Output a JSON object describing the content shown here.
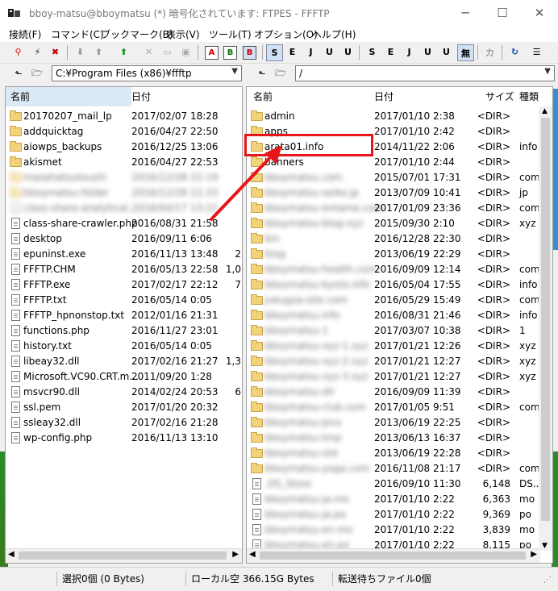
{
  "window": {
    "title": "bboy-matsu@bboymatsu (*) 暗号化されています: FTPES - FFFTP",
    "minimize_glyph": "─",
    "maximize_glyph": "☐",
    "close_glyph": "✕"
  },
  "menu": [
    "接続(F)",
    "コマンド(C)",
    "ブックマーク(B)",
    "表示(V)",
    "ツール(T)",
    "オプション(O)",
    "ヘルプ(H)"
  ],
  "toolbar": {
    "buttons_text": [
      "S",
      "E",
      "J",
      "U",
      "U",
      "S",
      "E",
      "J",
      "U",
      "U",
      "無",
      "カ"
    ],
    "badge_a": "A",
    "badge_b": "B",
    "badge_c": "B"
  },
  "local": {
    "path": "C:¥Program Files (x86)¥ffftp",
    "columns": {
      "name": "名前",
      "date": "日付"
    },
    "files": [
      {
        "name": "20170207_mail_lp",
        "date": "2017/02/07 18:28",
        "size": "",
        "type": "folder",
        "blur": false
      },
      {
        "name": "addquicktag",
        "date": "2016/04/27 22:50",
        "size": "",
        "type": "folder",
        "blur": false
      },
      {
        "name": "aiowps_backups",
        "date": "2016/12/25 13:06",
        "size": "",
        "type": "folder",
        "blur": false
      },
      {
        "name": "akismet",
        "date": "2016/04/27 22:53",
        "size": "",
        "type": "folder",
        "blur": false
      },
      {
        "name": "masahatsutoushi",
        "date": "2016/12/28 22:19",
        "size": "",
        "type": "folder",
        "blur": true
      },
      {
        "name": "bboymatsu-folder",
        "date": "2016/12/28 22:33",
        "size": "",
        "type": "folder",
        "blur": true
      },
      {
        "name": "class-share-analytical...",
        "date": "2016/04/17 13:22",
        "size": "",
        "type": "file",
        "blur": true
      },
      {
        "name": "class-share-crawler.php",
        "date": "2016/08/31 21:58",
        "size": "",
        "type": "file",
        "blur": false
      },
      {
        "name": "desktop",
        "date": "2016/09/11  6:06",
        "size": "",
        "type": "file",
        "blur": false
      },
      {
        "name": "epuninst.exe",
        "date": "2016/11/13 13:48",
        "size": "2",
        "type": "file",
        "blur": false
      },
      {
        "name": "FFFTP.CHM",
        "date": "2016/05/13 22:58",
        "size": "1,0",
        "type": "file",
        "blur": false
      },
      {
        "name": "FFFTP.exe",
        "date": "2017/02/17 22:12",
        "size": "7",
        "type": "file",
        "blur": false
      },
      {
        "name": "FFFTP.txt",
        "date": "2016/05/14  0:05",
        "size": "",
        "type": "file",
        "blur": false
      },
      {
        "name": "FFFTP_hpnonstop.txt",
        "date": "2012/01/16 21:31",
        "size": "",
        "type": "file",
        "blur": false
      },
      {
        "name": "functions.php",
        "date": "2016/11/27 23:01",
        "size": "",
        "type": "file",
        "blur": false
      },
      {
        "name": "history.txt",
        "date": "2016/05/14  0:05",
        "size": "",
        "type": "file",
        "blur": false
      },
      {
        "name": "libeay32.dll",
        "date": "2017/02/16 21:27",
        "size": "1,3",
        "type": "file",
        "blur": false
      },
      {
        "name": "Microsoft.VC90.CRT.m...",
        "date": "2011/09/20  1:28",
        "size": "",
        "type": "file",
        "blur": false
      },
      {
        "name": "msvcr90.dll",
        "date": "2014/02/24 20:53",
        "size": "6",
        "type": "file",
        "blur": false
      },
      {
        "name": "ssl.pem",
        "date": "2017/01/20 20:32",
        "size": "",
        "type": "file",
        "blur": false
      },
      {
        "name": "ssleay32.dll",
        "date": "2017/02/16 21:28",
        "size": "",
        "type": "file",
        "blur": false
      },
      {
        "name": "wp-config.php",
        "date": "2016/11/13 13:10",
        "size": "",
        "type": "file",
        "blur": false
      }
    ]
  },
  "remote": {
    "path": "/",
    "columns": {
      "name": "名前",
      "date": "日付",
      "size": "サイズ",
      "type": "種類"
    },
    "files": [
      {
        "name": "admin",
        "date": "2017/01/10  2:38",
        "size": "<DIR>",
        "ext": "",
        "type": "folder",
        "blur": false
      },
      {
        "name": "apps",
        "date": "2017/01/10  2:42",
        "size": "<DIR>",
        "ext": "",
        "type": "folder",
        "blur": false
      },
      {
        "name": "arata01.info",
        "date": "2014/11/22  2:06",
        "size": "<DIR>",
        "ext": "info",
        "type": "folder",
        "blur": false
      },
      {
        "name": "banners",
        "date": "2017/01/10  2:44",
        "size": "<DIR>",
        "ext": "",
        "type": "folder",
        "blur": false
      },
      {
        "name": "bboymatsu.com",
        "date": "2015/07/01 17:31",
        "size": "<DIR>",
        "ext": "com",
        "type": "folder",
        "blur": true
      },
      {
        "name": "bboymatsu-seiko.jp",
        "date": "2013/07/09 10:41",
        "size": "<DIR>",
        "ext": "jp",
        "type": "folder",
        "blur": true
      },
      {
        "name": "bboymatsu-entame.com",
        "date": "2017/01/09 23:36",
        "size": "<DIR>",
        "ext": "com",
        "type": "folder",
        "blur": true
      },
      {
        "name": "bboymatsu-blog-xyz",
        "date": "2015/09/30  2:10",
        "size": "<DIR>",
        "ext": "xyz",
        "type": "folder",
        "blur": true
      },
      {
        "name": "bin",
        "date": "2016/12/28 22:30",
        "size": "<DIR>",
        "ext": "",
        "type": "folder",
        "blur": true
      },
      {
        "name": "blog",
        "date": "2013/06/19 22:29",
        "size": "<DIR>",
        "ext": "",
        "type": "folder",
        "blur": true
      },
      {
        "name": "bboymatsu-health.com",
        "date": "2016/09/09 12:14",
        "size": "<DIR>",
        "ext": "com",
        "type": "folder",
        "blur": true
      },
      {
        "name": "bboymatsu-kyoto.info",
        "date": "2016/05/04 17:55",
        "size": "<DIR>",
        "ext": "info",
        "type": "folder",
        "blur": true
      },
      {
        "name": "jukugoa-site.com",
        "date": "2016/05/29 15:49",
        "size": "<DIR>",
        "ext": "com",
        "type": "folder",
        "blur": true
      },
      {
        "name": "bboymatsu.info",
        "date": "2016/08/31 21:46",
        "size": "<DIR>",
        "ext": "info",
        "type": "folder",
        "blur": true
      },
      {
        "name": "bboymatsu-1",
        "date": "2017/03/07 10:38",
        "size": "<DIR>",
        "ext": "1",
        "type": "folder",
        "blur": true
      },
      {
        "name": "bboymatsu-xyz-1.xyz",
        "date": "2017/01/21 12:26",
        "size": "<DIR>",
        "ext": "xyz",
        "type": "folder",
        "blur": true
      },
      {
        "name": "bboymatsu-xyz-2.xyz",
        "date": "2017/01/21 12:27",
        "size": "<DIR>",
        "ext": "xyz",
        "type": "folder",
        "blur": true
      },
      {
        "name": "bboymatsu-xyz-3.xyz",
        "date": "2017/01/21 12:27",
        "size": "<DIR>",
        "ext": "xyz",
        "type": "folder",
        "blur": true
      },
      {
        "name": "bboymatsu-dir",
        "date": "2016/09/09 11:39",
        "size": "<DIR>",
        "ext": "",
        "type": "folder",
        "blur": true
      },
      {
        "name": "bboymatsu-club.com",
        "date": "2017/01/05  9:51",
        "size": "<DIR>",
        "ext": "com",
        "type": "folder",
        "blur": true
      },
      {
        "name": "bboymatsu-pics",
        "date": "2013/06/19 22:25",
        "size": "<DIR>",
        "ext": "",
        "type": "folder",
        "blur": true
      },
      {
        "name": "bboymatsu-tmp",
        "date": "2013/06/13 16:37",
        "size": "<DIR>",
        "ext": "",
        "type": "folder",
        "blur": true
      },
      {
        "name": "bboymatsu-old",
        "date": "2013/06/19 22:28",
        "size": "<DIR>",
        "ext": "",
        "type": "folder",
        "blur": true
      },
      {
        "name": "bboymatsu-yoga.com",
        "date": "2016/11/08 21:17",
        "size": "<DIR>",
        "ext": "com",
        "type": "folder",
        "blur": true
      },
      {
        "name": ".DS_Store",
        "date": "2016/09/10 11:30",
        "size": "6,148",
        "ext": "DS...",
        "type": "file",
        "blur": true
      },
      {
        "name": "bboymatsu-ja.mo",
        "date": "2017/01/10  2:22",
        "size": "6,363",
        "ext": "mo",
        "type": "file",
        "blur": true
      },
      {
        "name": "bboymatsu-ja.po",
        "date": "2017/01/10  2:22",
        "size": "9,369",
        "ext": "po",
        "type": "file",
        "blur": true
      },
      {
        "name": "bboymatsu-en.mo",
        "date": "2017/01/10  2:22",
        "size": "3,839",
        "ext": "mo",
        "type": "file",
        "blur": true
      },
      {
        "name": "bboymatsu-en.po",
        "date": "2017/01/10  2:22",
        "size": "8,115",
        "ext": "po",
        "type": "file",
        "blur": true
      }
    ]
  },
  "status": {
    "selection": "選択0個 (0 Bytes)",
    "local_free": "ローカル空 366.15G Bytes",
    "queue": "転送待ちファイル0個"
  }
}
